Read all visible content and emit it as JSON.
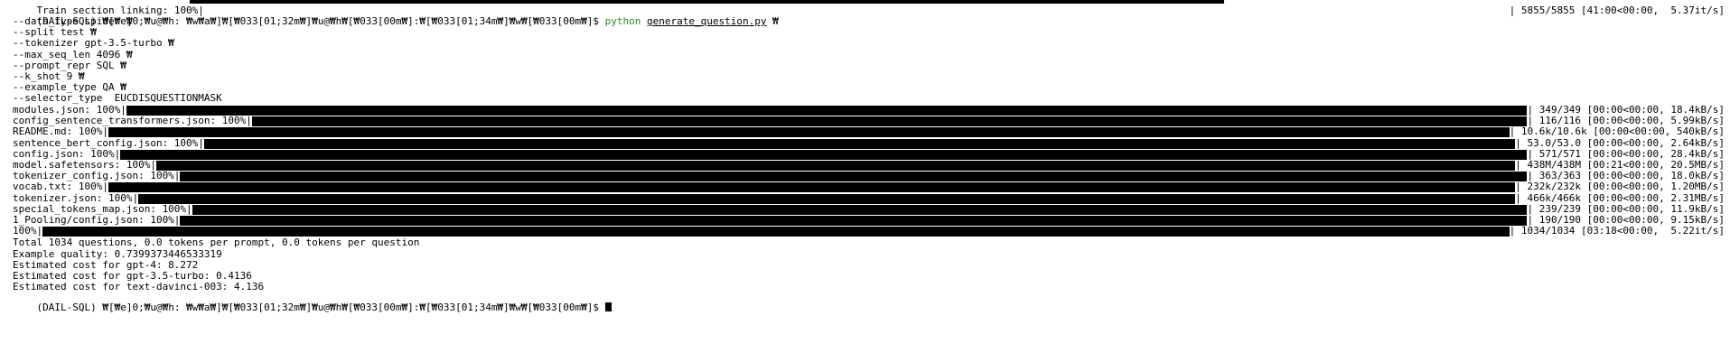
{
  "terminal": {
    "top_clipped_left": "Train section linking: 100%|",
    "top_clipped_right": "| 5855/5855 [41:00<00:00,  5.37it/s]",
    "prompt_env": "(DAIL-SQL) ",
    "prompt_mangled": "₩[₩e]0;₩u@₩h: ₩w₩a₩]₩[₩033[01;32m₩]₩u@₩h₩[₩033[00m₩]:₩[₩033[01;34m₩]₩w₩[₩033[00m₩]$ ",
    "command": "python",
    "script": "generate_question.py",
    "cont": " ₩",
    "args": [
      "--data_type spider ₩",
      "--split test ₩",
      "--tokenizer gpt-3.5-turbo ₩",
      "--max_seq_len 4096 ₩",
      "--prompt_repr SQL ₩",
      "--k_shot 9 ₩",
      "--example_type QA ₩",
      "--selector_type  EUCDISQUESTIONMASK"
    ],
    "progress": [
      {
        "label": "modules.json: 100%|",
        "stats": "| 349/349 [00:00<00:00, 18.4kB/s]",
        "fraction": 1.0
      },
      {
        "label": "config_sentence_transformers.json: 100%|",
        "stats": "| 116/116 [00:00<00:00, 5.99kB/s]",
        "fraction": 1.0
      },
      {
        "label": "README.md: 100%|",
        "stats": "| 10.6k/10.6k [00:00<00:00, 540kB/s]",
        "fraction": 1.0
      },
      {
        "label": "sentence_bert_config.json: 100%|",
        "stats": "| 53.0/53.0 [00:00<00:00, 2.64kB/s]",
        "fraction": 1.0
      },
      {
        "label": "config.json: 100%|",
        "stats": "| 571/571 [00:00<00:00, 28.4kB/s]",
        "fraction": 1.0
      },
      {
        "label": "model.safetensors: 100%|",
        "stats": "| 438M/438M [00:21<00:00, 20.5MB/s]",
        "fraction": 1.0
      },
      {
        "label": "tokenizer_config.json: 100%|",
        "stats": "| 363/363 [00:00<00:00, 18.0kB/s]",
        "fraction": 1.0
      },
      {
        "label": "vocab.txt: 100%|",
        "stats": "| 232k/232k [00:00<00:00, 1.20MB/s]",
        "fraction": 1.0
      },
      {
        "label": "tokenizer.json: 100%|",
        "stats": "| 466k/466k [00:00<00:00, 2.31MB/s]",
        "fraction": 1.0
      },
      {
        "label": "special_tokens_map.json: 100%|",
        "stats": "| 239/239 [00:00<00:00, 11.9kB/s]",
        "fraction": 1.0
      },
      {
        "label": "1_Pooling/config.json: 100%|",
        "stats": "| 190/190 [00:00<00:00, 9.15kB/s]",
        "fraction": 1.0
      },
      {
        "label": "100%|",
        "stats": "| 1034/1034 [03:18<00:00,  5.22it/s]",
        "fraction": 1.0
      }
    ],
    "output": [
      "Total 1034 questions, 0.0 tokens per prompt, 0.0 tokens per question",
      "Example quality: 0.7399373446533319",
      "Estimated cost for gpt-4: 8.272",
      "Estimated cost for gpt-3.5-turbo: 0.4136",
      "Estimated cost for text-davinci-003: 4.136"
    ],
    "final_prompt": "(DAIL-SQL) ₩[₩e]0;₩u@₩h: ₩w₩a₩]₩[₩033[01;32m₩]₩u@₩h₩[₩033[00m₩]:₩[₩033[01;34m₩]₩w₩[₩033[00m₩]$ "
  },
  "colors": {
    "background": "#ffffff",
    "foreground": "#000000",
    "prompt_green": "#2a8a2a"
  }
}
